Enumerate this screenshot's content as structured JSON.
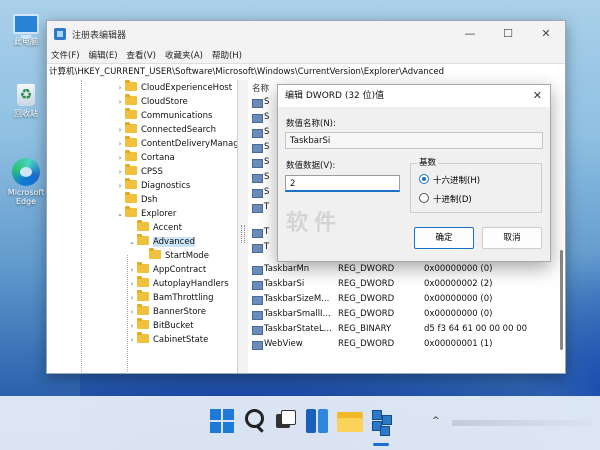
{
  "desktop": {
    "icons": [
      {
        "label": "此电脑",
        "icon": "computer-icon"
      },
      {
        "label": "回收站",
        "icon": "recycle-bin-icon"
      },
      {
        "label": "Microsoft Edge",
        "icon": "edge-icon"
      }
    ]
  },
  "window": {
    "title": "注册表编辑器",
    "controls": {
      "minimize": "—",
      "maximize": "☐",
      "close": "✕"
    },
    "menu": [
      "文件(F)",
      "编辑(E)",
      "查看(V)",
      "收藏夹(A)",
      "帮助(H)"
    ],
    "address": "计算机\\HKEY_CURRENT_USER\\Software\\Microsoft\\Windows\\CurrentVersion\\Explorer\\Advanced"
  },
  "tree": {
    "items": [
      {
        "label": "CloudExperienceHost",
        "toggle": "›",
        "level": 0
      },
      {
        "label": "CloudStore",
        "toggle": "›",
        "level": 0
      },
      {
        "label": "Communications",
        "toggle": "",
        "level": 0
      },
      {
        "label": "ConnectedSearch",
        "toggle": "›",
        "level": 0
      },
      {
        "label": "ContentDeliveryManag",
        "toggle": "›",
        "level": 0
      },
      {
        "label": "Cortana",
        "toggle": "›",
        "level": 0
      },
      {
        "label": "CPSS",
        "toggle": "›",
        "level": 0
      },
      {
        "label": "Diagnostics",
        "toggle": "›",
        "level": 0
      },
      {
        "label": "Dsh",
        "toggle": "",
        "level": 0
      },
      {
        "label": "Explorer",
        "toggle": "⌄",
        "level": 0
      },
      {
        "label": "Accent",
        "toggle": "",
        "level": 1
      },
      {
        "label": "Advanced",
        "toggle": "⌄",
        "level": 1,
        "selected": true
      },
      {
        "label": "StartMode",
        "toggle": "",
        "level": 2
      },
      {
        "label": "AppContract",
        "toggle": "›",
        "level": 1
      },
      {
        "label": "AutoplayHandlers",
        "toggle": "›",
        "level": 1
      },
      {
        "label": "BamThrottling",
        "toggle": "›",
        "level": 1
      },
      {
        "label": "BannerStore",
        "toggle": "›",
        "level": 1
      },
      {
        "label": "BitBucket",
        "toggle": "›",
        "level": 1
      },
      {
        "label": "CabinetState",
        "toggle": "›",
        "level": 1
      }
    ]
  },
  "values_pane": {
    "column_name": "名称",
    "partial_rows": [
      "S",
      "S",
      "S",
      "S",
      "S",
      "S",
      "S",
      "T",
      "T",
      "T"
    ],
    "rows": [
      {
        "name": "TaskbarMn",
        "type": "REG_DWORD",
        "data": "0x00000000 (0)"
      },
      {
        "name": "TaskbarSi",
        "type": "REG_DWORD",
        "data": "0x00000002 (2)"
      },
      {
        "name": "TaskbarSizeM...",
        "type": "REG_DWORD",
        "data": "0x00000000 (0)"
      },
      {
        "name": "TaskbarSmallI...",
        "type": "REG_DWORD",
        "data": "0x00000000 (0)"
      },
      {
        "name": "TaskbarStateL...",
        "type": "REG_BINARY",
        "data": "d5 f3 64 61 00 00 00 00"
      },
      {
        "name": "WebView",
        "type": "REG_DWORD",
        "data": "0x00000001 (1)"
      }
    ]
  },
  "dialog": {
    "title": "编辑 DWORD (32 位)值",
    "close": "✕",
    "name_label": "数值名称(N):",
    "name_value": "TaskbarSi",
    "data_label": "数值数据(V):",
    "data_value": "2",
    "base_label": "基数",
    "base_options": [
      {
        "label": "十六进制(H)",
        "selected": true
      },
      {
        "label": "十进制(D)",
        "selected": false
      }
    ],
    "ok": "确定",
    "cancel": "取消"
  },
  "watermark": "软件",
  "taskbar": {
    "chevron": "^",
    "apps": [
      "start-icon",
      "search-icon",
      "task-view-icon",
      "widgets-icon",
      "file-explorer-icon",
      "registry-editor-icon"
    ]
  }
}
